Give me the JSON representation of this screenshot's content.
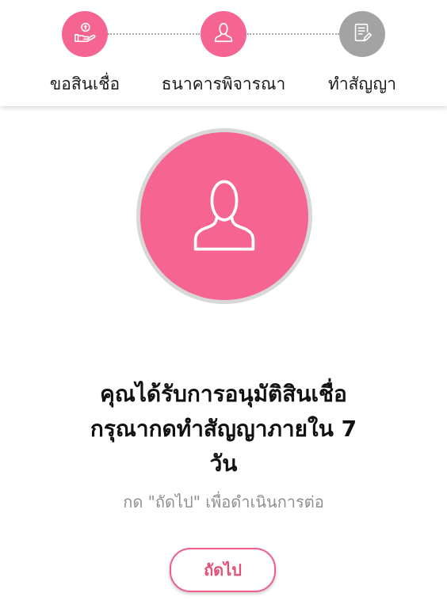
{
  "colors": {
    "accent": "#f66491",
    "inactive": "#a3a3a3",
    "button_border": "#ee5f87",
    "button_text": "#e0507b",
    "subtext": "#8f8f8f"
  },
  "stepper": {
    "steps": [
      {
        "label": "ขอสินเชื่อ",
        "icon": "hand-money-icon",
        "state": "completed"
      },
      {
        "label": "ธนาคารพิจารณา",
        "icon": "user-icon",
        "state": "active"
      },
      {
        "label": "ทำสัญญา",
        "icon": "document-sign-icon",
        "state": "inactive"
      }
    ]
  },
  "hero": {
    "icon": "user-icon"
  },
  "message": {
    "line1": "คุณได้รับการอนุมัติสินเชื่อ",
    "line2": "กรุณากดทำสัญญาภายใน 7",
    "line3": "วัน",
    "hint": "กด \"ถัดไป\" เพื่อดำเนินการต่อ"
  },
  "actions": {
    "next_label": "ถัดไป"
  }
}
